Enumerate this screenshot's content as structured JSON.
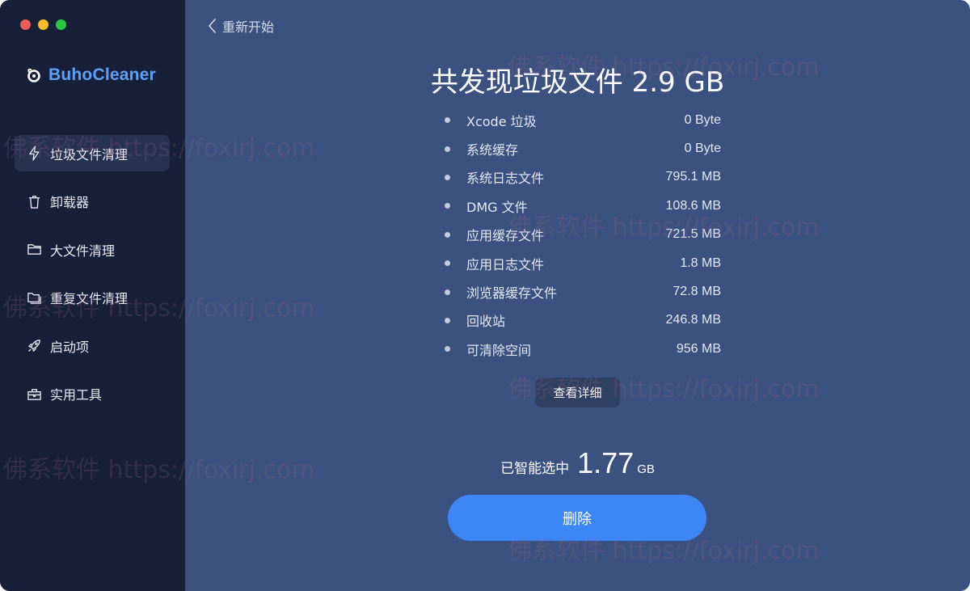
{
  "app": {
    "name": "BuhoCleaner"
  },
  "window_controls": [
    "close",
    "minimize",
    "zoom"
  ],
  "sidebar": {
    "items": [
      {
        "label": "垃圾文件清理",
        "icon": "bolt-icon",
        "active": true
      },
      {
        "label": "卸载器",
        "icon": "trash-icon",
        "active": false
      },
      {
        "label": "大文件清理",
        "icon": "folder-icon",
        "active": false
      },
      {
        "label": "重复文件清理",
        "icon": "duplicate-folder-icon",
        "active": false
      },
      {
        "label": "启动项",
        "icon": "rocket-icon",
        "active": false
      },
      {
        "label": "实用工具",
        "icon": "toolbox-icon",
        "active": false
      }
    ]
  },
  "header": {
    "back_label": "重新开始"
  },
  "result": {
    "title": "共发现垃圾文件 2.9 GB",
    "items": [
      {
        "name": "Xcode 垃圾",
        "size": "0 Byte"
      },
      {
        "name": "系统缓存",
        "size": "0 Byte"
      },
      {
        "name": "系统日志文件",
        "size": "795.1 MB"
      },
      {
        "name": "DMG 文件",
        "size": "108.6 MB"
      },
      {
        "name": "应用缓存文件",
        "size": "721.5 MB"
      },
      {
        "name": "应用日志文件",
        "size": "1.8 MB"
      },
      {
        "name": "浏览器缓存文件",
        "size": "72.8 MB"
      },
      {
        "name": "回收站",
        "size": "246.8 MB"
      },
      {
        "name": "可清除空间",
        "size": "956 MB"
      }
    ],
    "details_label": "查看详细",
    "selected_label": "已智能选中",
    "selected_value": "1.77",
    "selected_unit": "GB",
    "delete_label": "删除"
  },
  "watermark": {
    "text": "佛系软件 https://foxirj.com"
  },
  "colors": {
    "sidebar_bg": "#172038",
    "main_bg": "#3b5280",
    "accent": "#3d86f6",
    "brand": "#5ea0f7"
  }
}
